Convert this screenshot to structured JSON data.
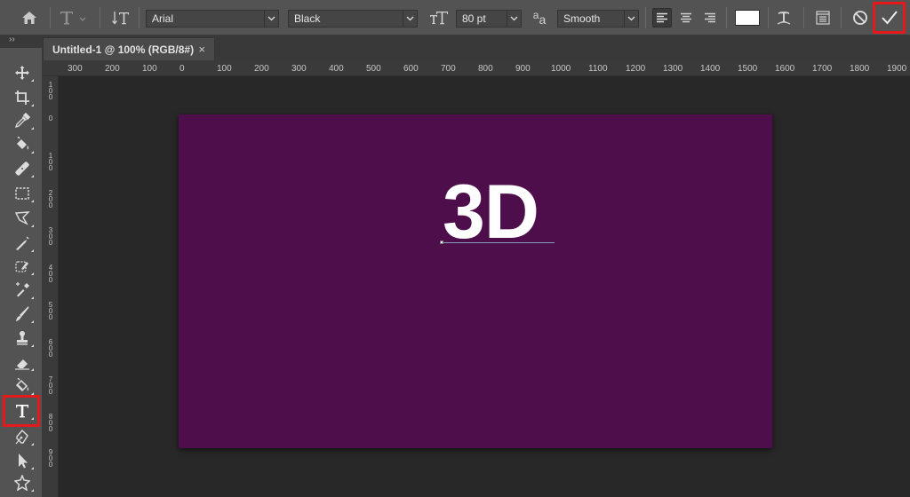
{
  "options_bar": {
    "font_family": "Arial",
    "font_style": "Black",
    "font_size": "80 pt",
    "anti_alias_icon_text": "a",
    "anti_alias_icon_text2": "a",
    "anti_alias": "Smooth",
    "text_color": "#ffffff"
  },
  "document": {
    "tab_title": "Untitled-1 @ 100% (RGB/8#)",
    "close_glyph": "×",
    "collapse_glyph": "››",
    "canvas_color": "#4d0e4b",
    "text": "3D"
  },
  "rulers": {
    "horizontal": [
      "300",
      "200",
      "100",
      "0",
      "100",
      "200",
      "300",
      "400",
      "500",
      "600",
      "700",
      "800",
      "900",
      "1000",
      "1100",
      "1200",
      "1300",
      "1400",
      "1500",
      "1600",
      "1700",
      "1800",
      "1900"
    ],
    "vertical": [
      "100",
      "0",
      "100",
      "200",
      "300",
      "400",
      "500",
      "600",
      "700",
      "800",
      "900"
    ]
  },
  "highlight_color": "#e3191b"
}
